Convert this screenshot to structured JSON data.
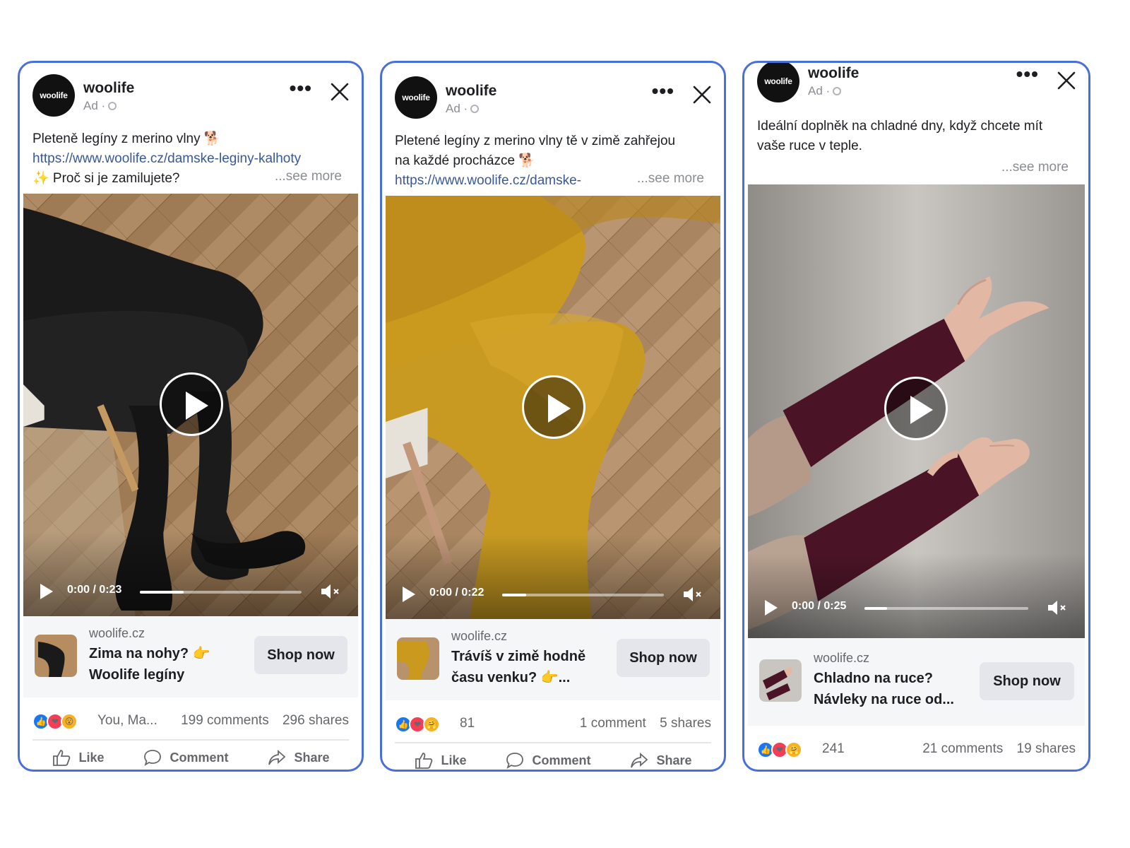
{
  "cards": [
    {
      "page_name": "woolife",
      "avatar_text": "woolife",
      "ad_label": "Ad ·",
      "caption_lines": [
        "Pleteně legíny z merino vlny 🐕",
        "https://www.woolife.cz/damske-leginy-kalhoty",
        "✨ Proč si je zamilujete?"
      ],
      "see_more": "...see more",
      "video_time": "0:00 / 0:23",
      "video_progress": 0.27,
      "cta_domain": "woolife.cz",
      "cta_title": "Zima na nohy? 👉 Woolife legíny",
      "cta_button": "Shop now",
      "reaction_text": "You, Ma...",
      "comments": "199 comments",
      "shares": "296 shares",
      "actions": [
        "Like",
        "Comment",
        "Share"
      ]
    },
    {
      "page_name": "woolife",
      "avatar_text": "woolife",
      "ad_label": "Ad ·",
      "caption_lines": [
        "Pletené legíny z merino vlny tě v zimě zahřejou",
        "na každé procházce 🐕",
        "https://www.woolife.cz/damske-"
      ],
      "see_more": "...see more",
      "video_time": "0:00 / 0:22",
      "video_progress": 0.15,
      "cta_domain": "woolife.cz",
      "cta_title": "Trávíš v zimě hodně času venku? 👉...",
      "cta_button": "Shop now",
      "reaction_text": "81",
      "comments": "1 comment",
      "shares": "5 shares",
      "actions": [
        "Like",
        "Comment",
        "Share"
      ]
    },
    {
      "page_name": "woolife",
      "avatar_text": "woolife",
      "ad_label": "Ad ·",
      "caption_lines": [
        "Ideální doplněk na chladné dny, když chcete mít",
        "vaše ruce v teple."
      ],
      "see_more": "...see more",
      "video_time": "0:00 / 0:25",
      "video_progress": 0.14,
      "cta_domain": "woolife.cz",
      "cta_title": "Chladno na ruce? Návleky na ruce od...",
      "cta_button": "Shop now",
      "reaction_text": "241",
      "comments": "21 comments",
      "shares": "19 shares",
      "actions": []
    }
  ],
  "colors": {
    "card_border": "#4b6fd8",
    "link": "#385898",
    "tights_black": "#1a1a1a",
    "tights_mustard": "#c99a1e",
    "mitts_burgundy": "#4a1426"
  }
}
